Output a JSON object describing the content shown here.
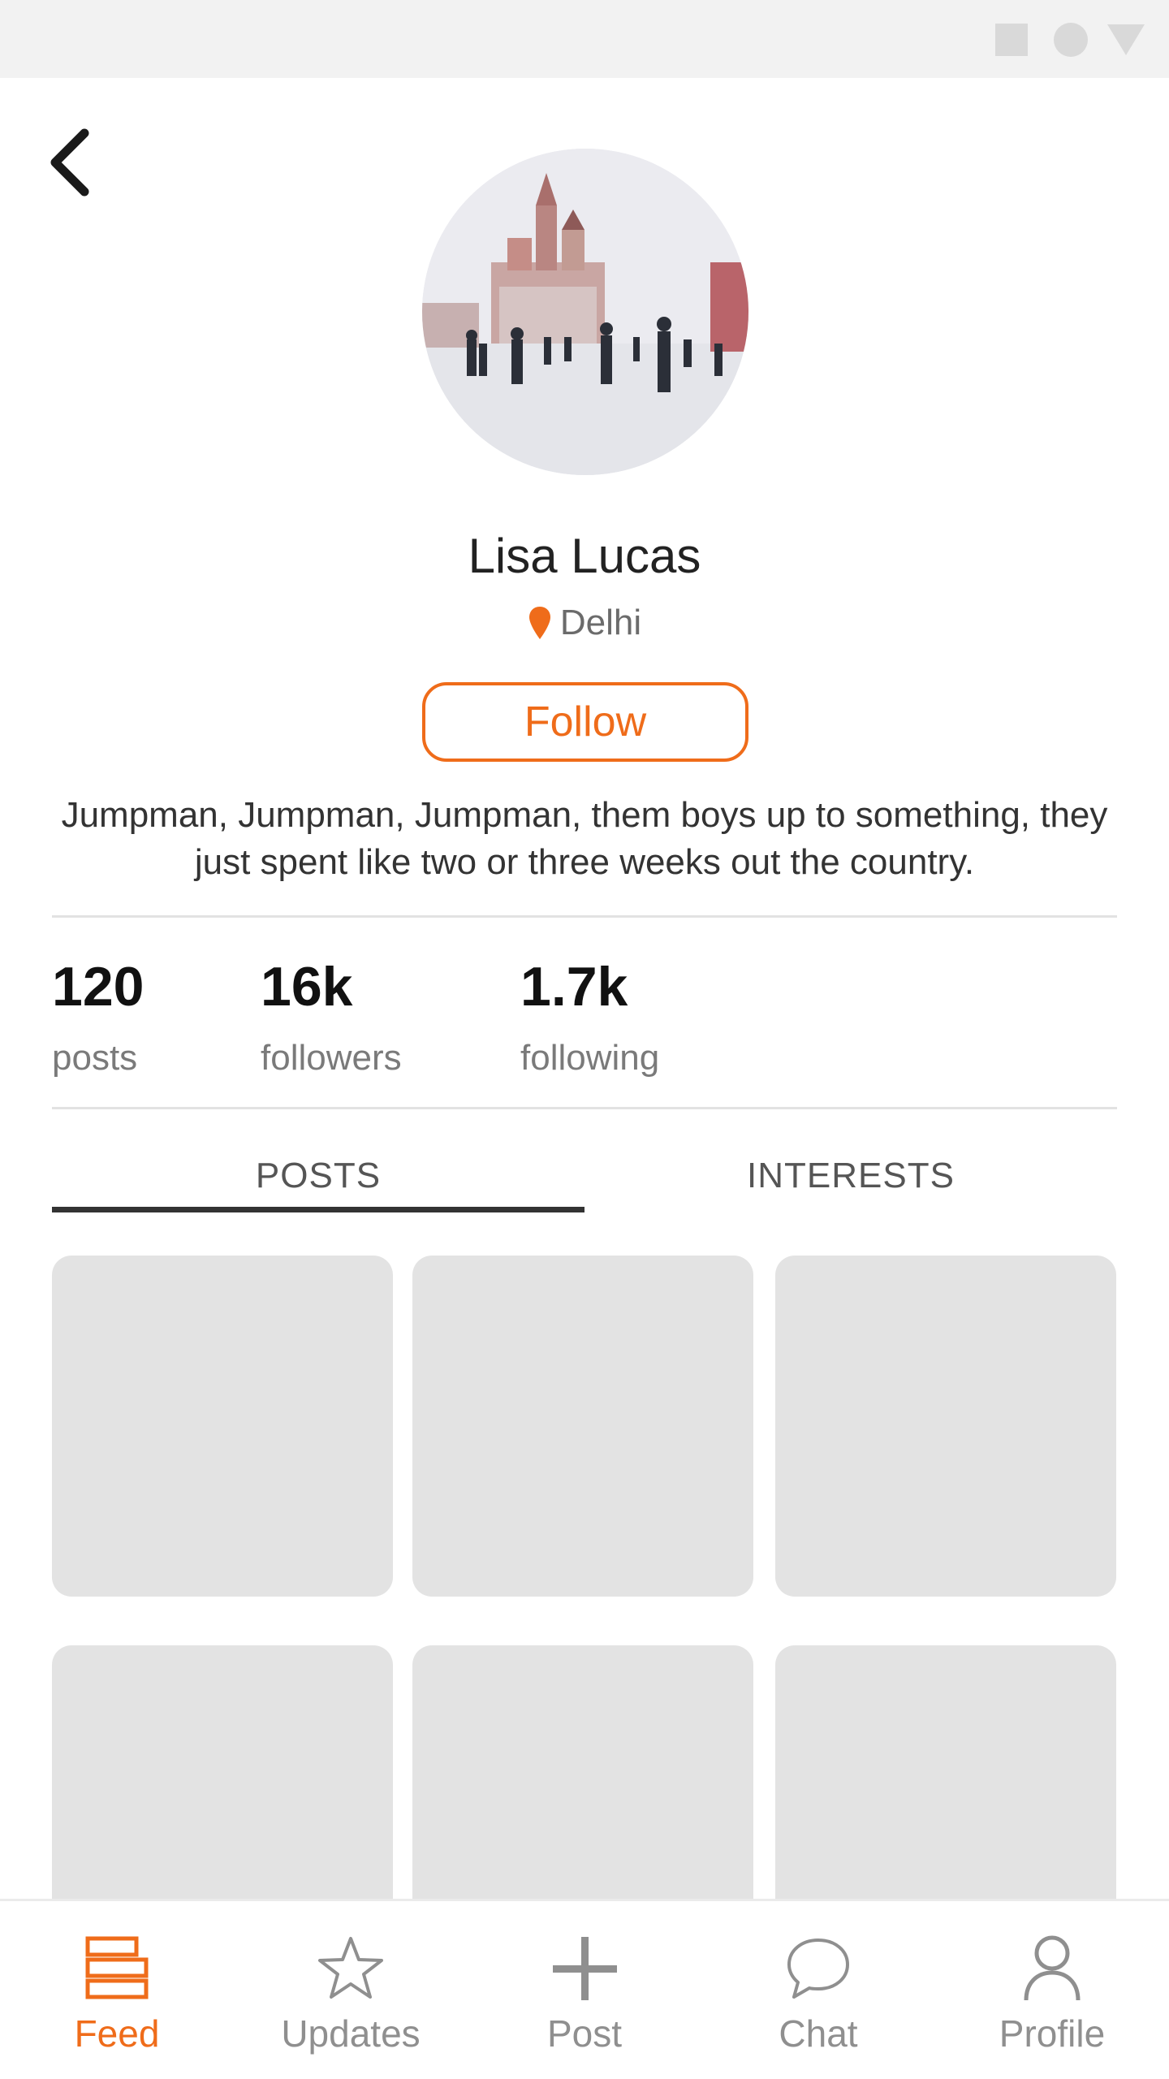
{
  "profile": {
    "name": "Lisa Lucas",
    "location": "Delhi",
    "follow_label": "Follow",
    "bio": "Jumpman, Jumpman, Jumpman, them boys up to something, they just spent like two or three weeks out the country."
  },
  "stats": [
    {
      "value": "120",
      "label": "posts"
    },
    {
      "value": "16k",
      "label": "followers"
    },
    {
      "value": "1.7k",
      "label": "following"
    }
  ],
  "tabs": [
    {
      "label": "POSTS",
      "active": true
    },
    {
      "label": "INTERESTS",
      "active": false
    }
  ],
  "nav": [
    {
      "label": "Feed",
      "icon": "feed-icon",
      "active": true
    },
    {
      "label": "Updates",
      "icon": "star-icon",
      "active": false
    },
    {
      "label": "Post",
      "icon": "plus-icon",
      "active": false
    },
    {
      "label": "Chat",
      "icon": "chat-bubble-icon",
      "active": false
    },
    {
      "label": "Profile",
      "icon": "person-icon",
      "active": false
    }
  ],
  "colors": {
    "accent": "#ef6c1a",
    "placeholder_tile": "#e3e3e3",
    "status_bar": "#f2f2f2"
  }
}
